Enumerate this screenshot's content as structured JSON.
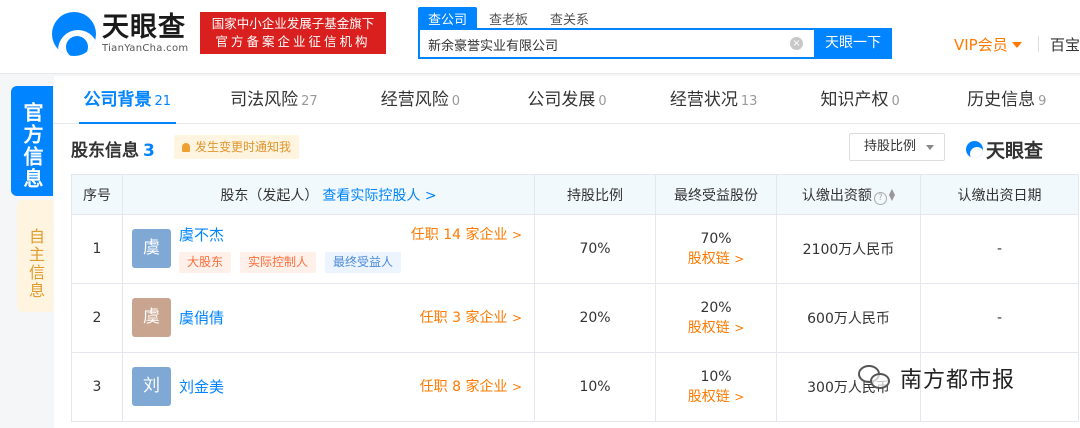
{
  "header": {
    "logo_cn": "天眼查",
    "logo_en": "TianYanCha.com",
    "gov_badge_line1": "国家中小企业发展子基金旗下",
    "gov_badge_line2": "官方备案企业征信机构",
    "search_tabs": [
      "查公司",
      "查老板",
      "查关系"
    ],
    "search_value": "新余豪誉实业有限公司",
    "search_button": "天眼一下",
    "vip_label": "VIP会员",
    "cut_menu": "百宝"
  },
  "side_tabs": {
    "active": "官方信息",
    "inactive": "自主信息"
  },
  "tabs": [
    {
      "label": "公司背景",
      "count": "21"
    },
    {
      "label": "司法风险",
      "count": "27"
    },
    {
      "label": "经营风险",
      "count": "0"
    },
    {
      "label": "公司发展",
      "count": "0"
    },
    {
      "label": "经营状况",
      "count": "13"
    },
    {
      "label": "知识产权",
      "count": "0"
    },
    {
      "label": "历史信息",
      "count": "9"
    }
  ],
  "section": {
    "title": "股东信息",
    "count": "3",
    "notify_label": "发生变更时通知我",
    "ratio_select": "持股比例",
    "brand": "天眼查"
  },
  "table": {
    "headers": {
      "idx": "序号",
      "holder": "股东（发起人）",
      "holder_link": "查看实际控股人 >",
      "ratio": "持股比例",
      "final": "最终受益股份",
      "capital": "认缴出资额",
      "date": "认缴出资日期"
    },
    "rows": [
      {
        "idx": "1",
        "avatar_char": "虞",
        "avatar_color": "#7fa8d4",
        "name": "虞不杰",
        "job": "任职 14 家企业",
        "tags": [
          "大股东",
          "实际控制人",
          "最终受益人"
        ],
        "ratio": "70%",
        "final_pct": "70%",
        "final_link": "股权链",
        "capital": "2100万人民币",
        "date": "-"
      },
      {
        "idx": "2",
        "avatar_char": "虞",
        "avatar_color": "#c9a48f",
        "name": "虞俏倩",
        "job": "任职 3 家企业",
        "tags": [],
        "ratio": "20%",
        "final_pct": "20%",
        "final_link": "股权链",
        "capital": "600万人民币",
        "date": "-"
      },
      {
        "idx": "3",
        "avatar_char": "刘",
        "avatar_color": "#7fa8d4",
        "name": "刘金美",
        "job": "任职 8 家企业",
        "tags": [],
        "ratio": "10%",
        "final_pct": "10%",
        "final_link": "股权链",
        "capital": "300万人民币",
        "date": ""
      }
    ]
  },
  "watermark": "南方都市报"
}
